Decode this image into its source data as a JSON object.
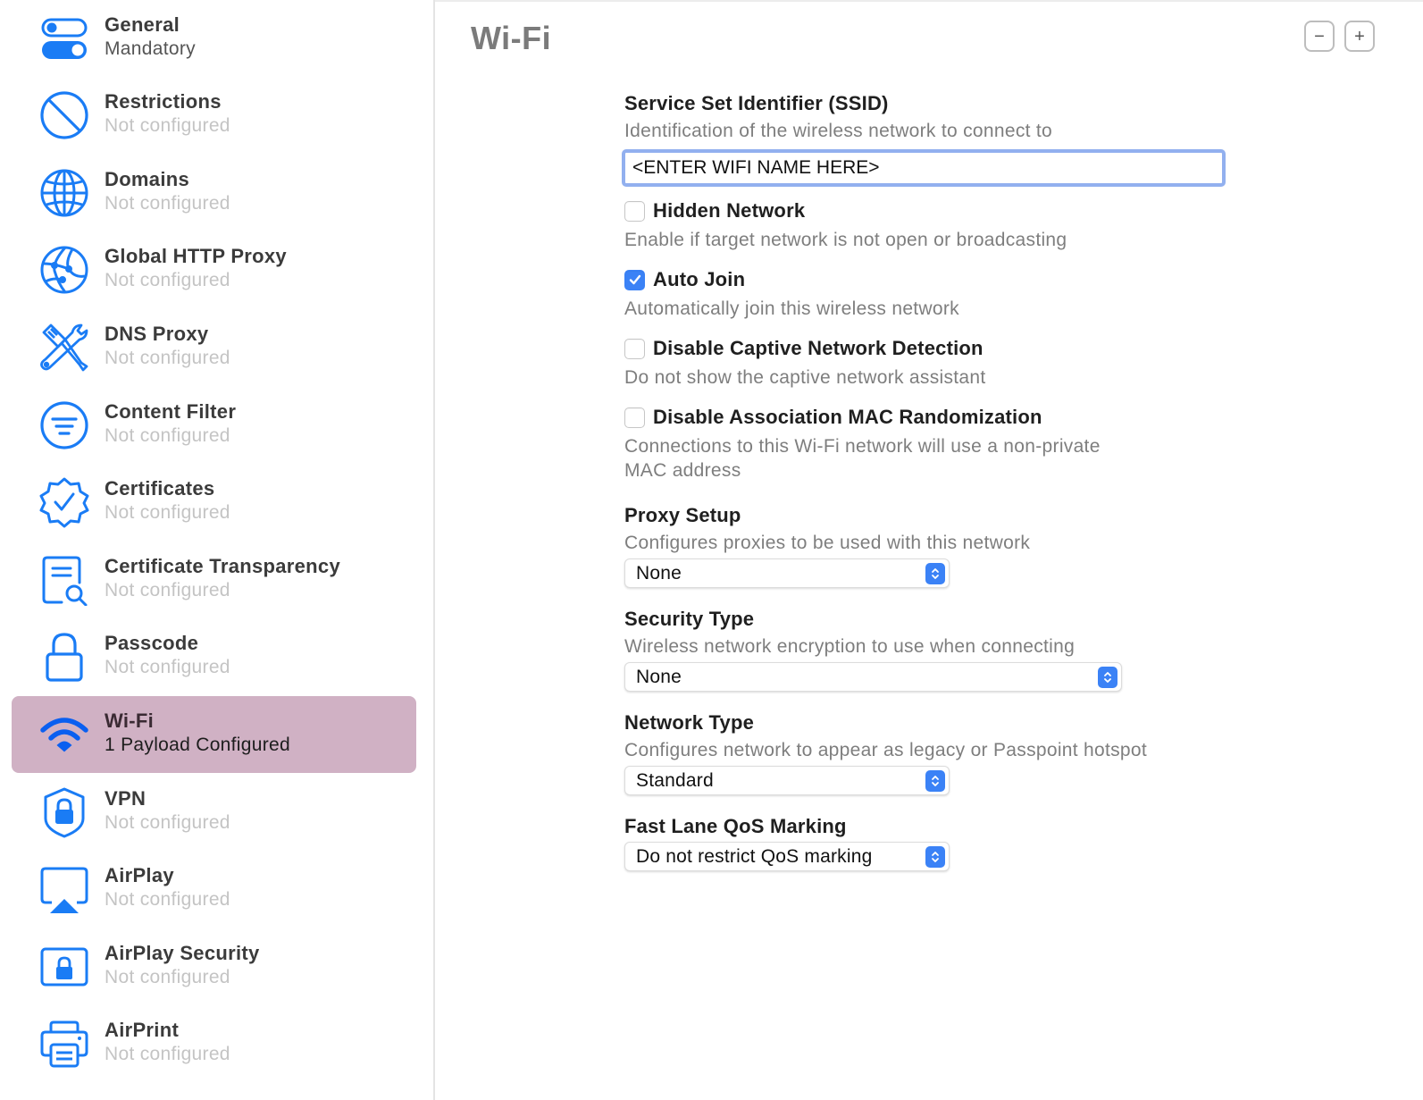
{
  "sidebar": {
    "items": [
      {
        "title": "General",
        "subtitle": "Mandatory",
        "icon": "toggles-icon",
        "selected": false
      },
      {
        "title": "Restrictions",
        "subtitle": "Not configured",
        "icon": "prohibited-icon",
        "selected": false
      },
      {
        "title": "Domains",
        "subtitle": "Not configured",
        "icon": "globe-icon",
        "selected": false
      },
      {
        "title": "Global HTTP Proxy",
        "subtitle": "Not configured",
        "icon": "network-globe-icon",
        "selected": false
      },
      {
        "title": "DNS Proxy",
        "subtitle": "Not configured",
        "icon": "tools-icon",
        "selected": false
      },
      {
        "title": "Content Filter",
        "subtitle": "Not configured",
        "icon": "filter-icon",
        "selected": false
      },
      {
        "title": "Certificates",
        "subtitle": "Not configured",
        "icon": "checkmark-seal-icon",
        "selected": false
      },
      {
        "title": "Certificate Transparency",
        "subtitle": "Not configured",
        "icon": "document-search-icon",
        "selected": false
      },
      {
        "title": "Passcode",
        "subtitle": "Not configured",
        "icon": "lock-icon",
        "selected": false
      },
      {
        "title": "Wi-Fi",
        "subtitle": "1 Payload Configured",
        "icon": "wifi-icon",
        "selected": true
      },
      {
        "title": "VPN",
        "subtitle": "Not configured",
        "icon": "lock-shield-icon",
        "selected": false
      },
      {
        "title": "AirPlay",
        "subtitle": "Not configured",
        "icon": "airplay-icon",
        "selected": false
      },
      {
        "title": "AirPlay Security",
        "subtitle": "Not configured",
        "icon": "airplay-lock-icon",
        "selected": false
      },
      {
        "title": "AirPrint",
        "subtitle": "Not configured",
        "icon": "printer-icon",
        "selected": false
      }
    ]
  },
  "header": {
    "title": "Wi-Fi",
    "remove_label": "−",
    "add_label": "+"
  },
  "form": {
    "ssid": {
      "label": "Service Set Identifier (SSID)",
      "description": "Identification of the wireless network to connect to",
      "value": "<ENTER WIFI NAME HERE>"
    },
    "hidden_network": {
      "label": "Hidden Network",
      "description": "Enable if target network is not open or broadcasting",
      "checked": false
    },
    "auto_join": {
      "label": "Auto Join",
      "description": "Automatically join this wireless network",
      "checked": true
    },
    "disable_captive": {
      "label": "Disable Captive Network Detection",
      "description": "Do not show the captive network assistant",
      "checked": false
    },
    "disable_mac_random": {
      "label": "Disable Association MAC Randomization",
      "description_line1": "Connections to this Wi-Fi network will use a non-private",
      "description_line2": "MAC address",
      "checked": false
    },
    "proxy_setup": {
      "label": "Proxy Setup",
      "description": "Configures proxies to be used with this network",
      "value": "None"
    },
    "security_type": {
      "label": "Security Type",
      "description": "Wireless network encryption to use when connecting",
      "value": "None"
    },
    "network_type": {
      "label": "Network Type",
      "description": "Configures network to appear as legacy or Passpoint hotspot",
      "value": "Standard"
    },
    "fast_lane": {
      "label": "Fast Lane QoS Marking",
      "value": "Do not restrict QoS marking"
    }
  },
  "colors": {
    "accent": "#1a7cf5",
    "selected_row": "#d0b1c4",
    "focus_ring": "#92b0ef",
    "checkbox_checked": "#3b82f6"
  }
}
